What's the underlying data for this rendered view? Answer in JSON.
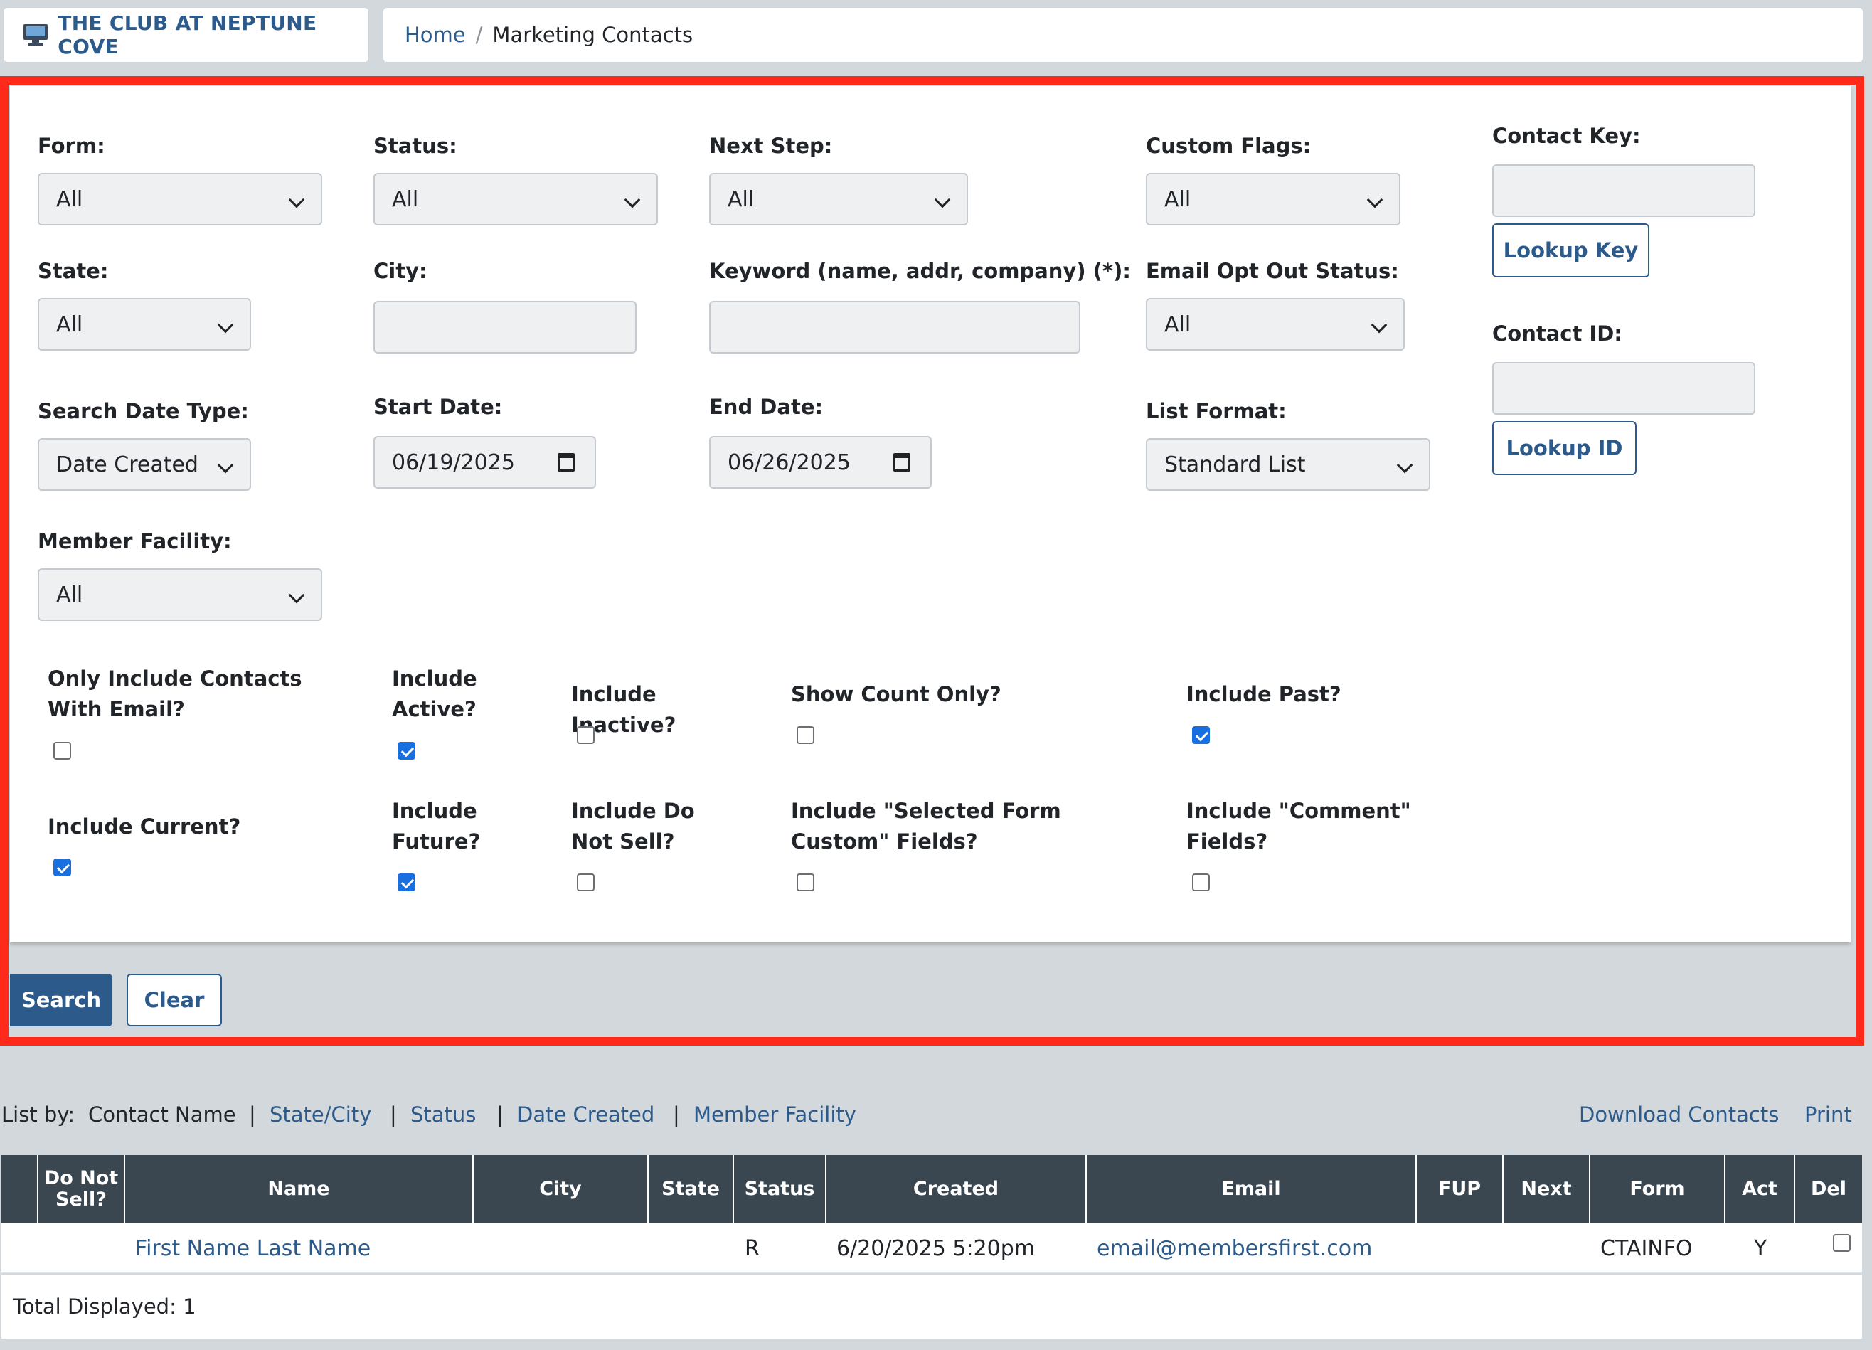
{
  "header": {
    "brand_title": "THE CLUB AT NEPTUNE COVE",
    "breadcrumb_home": "Home",
    "breadcrumb_sep": "/",
    "breadcrumb_current": "Marketing Contacts"
  },
  "filters": {
    "form_label": "Form:",
    "form_value": "All",
    "status_label": "Status:",
    "status_value": "All",
    "next_step_label": "Next Step:",
    "next_step_value": "All",
    "custom_flags_label": "Custom Flags:",
    "custom_flags_value": "All",
    "contact_key_label": "Contact Key:",
    "contact_key_value": "",
    "lookup_key_label": "Lookup Key",
    "state_label": "State:",
    "state_value": "All",
    "city_label": "City:",
    "city_value": "",
    "keyword_label": "Keyword (name, addr, company) (*):",
    "keyword_value": "",
    "email_opt_label": "Email Opt Out Status:",
    "email_opt_value": "All",
    "contact_id_label": "Contact ID:",
    "contact_id_value": "",
    "lookup_id_label": "Lookup ID",
    "search_date_type_label": "Search Date Type:",
    "search_date_type_value": "Date Created",
    "start_date_label": "Start Date:",
    "start_date_value": "06/19/2025",
    "end_date_label": "End Date:",
    "end_date_value": "06/26/2025",
    "list_format_label": "List Format:",
    "list_format_value": "Standard List",
    "member_facility_label": "Member Facility:",
    "member_facility_value": "All"
  },
  "checkboxes": {
    "only_email": {
      "label": "Only Include Contacts With Email?",
      "checked": false
    },
    "include_active": {
      "label": "Include Active?",
      "checked": true
    },
    "include_inactive": {
      "label": "Include Inactive?",
      "checked": false
    },
    "show_count_only": {
      "label": "Show Count Only?",
      "checked": false
    },
    "include_past": {
      "label": "Include Past?",
      "checked": true
    },
    "include_current": {
      "label": "Include Current?",
      "checked": true
    },
    "include_future": {
      "label": "Include Future?",
      "checked": true
    },
    "include_do_not_sell": {
      "label": "Include Do Not Sell?",
      "checked": false
    },
    "include_selected_form_custom": {
      "label": "Include \"Selected Form Custom\" Fields?",
      "checked": false
    },
    "include_comment": {
      "label": "Include \"Comment\" Fields?",
      "checked": false
    }
  },
  "actions": {
    "search_label": "Search",
    "clear_label": "Clear"
  },
  "list_by": {
    "prefix": "List by:",
    "current": "Contact Name",
    "sep": "|",
    "options": [
      "State/City",
      "Status",
      "Date Created",
      "Member Facility"
    ],
    "download": "Download Contacts",
    "print": "Print"
  },
  "table": {
    "headers": [
      "Do Not Sell?",
      "Name",
      "City",
      "State",
      "Status",
      "Created",
      "Email",
      "FUP",
      "Next",
      "Form",
      "Act",
      "Del"
    ],
    "rows": [
      {
        "do_not_sell": "",
        "name": "First Name Last Name",
        "city": "",
        "state": "",
        "status": "R",
        "created": "6/20/2025 5:20pm",
        "email": "email@membersfirst.com",
        "fup": "",
        "next": "",
        "form": "CTAINFO",
        "act": "Y",
        "del": false
      }
    ],
    "total_displayed": "Total Displayed: 1"
  },
  "colors": {
    "accent": "#2c5a8a",
    "annotation_red": "#ff2a1a",
    "table_header": "#3b4750",
    "checkbox_checked": "#1a6fe0"
  }
}
